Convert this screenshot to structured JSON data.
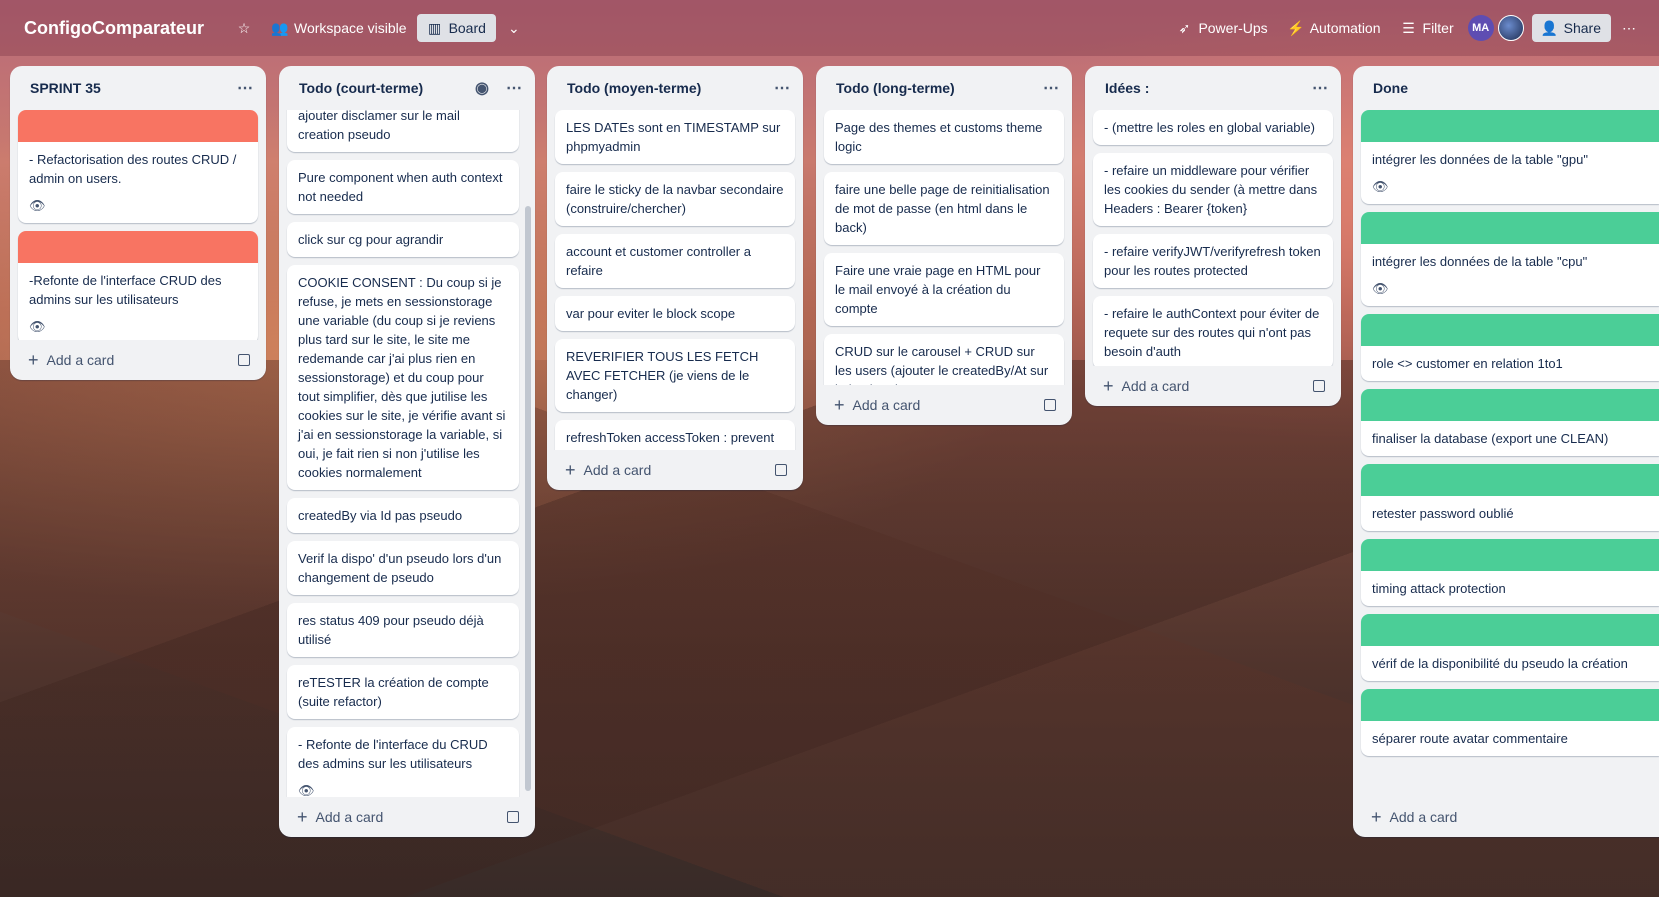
{
  "header": {
    "board_title": "ConfigoComparateur",
    "visibility_label": "Workspace visible",
    "view_label": "Board",
    "powerups_label": "Power-Ups",
    "automation_label": "Automation",
    "filter_label": "Filter",
    "avatar_initials": "MA",
    "share_label": "Share"
  },
  "colors": {
    "red_cover": "#f87462",
    "green_cover": "#4bce97"
  },
  "add_card_label": "Add a card",
  "lists": [
    {
      "title": "SPRINT 35",
      "cards": [
        {
          "text": "- Refactorisation des routes CRUD / admin on users."
        },
        {
          "text": "-Refonte de l'interface CRUD des admins sur les utilisateurs"
        }
      ]
    },
    {
      "title": "Todo (court-terme)",
      "cards": [
        {
          "text": "ajouter disclamer sur le mail creation pseudo"
        },
        {
          "text": "Pure component when auth context not needed"
        },
        {
          "text": "click sur cg pour agrandir"
        },
        {
          "text": "COOKIE CONSENT : Du coup si je refuse, je mets en sessionstorage une variable (du coup si je reviens plus tard sur le site, le site me redemande car j'ai plus rien en sessionstorage) et du coup pour tout simplifier, dès que jutilise les cookies sur le site, je vérifie avant si j'ai en sessionstorage la variable, si oui, je fait rien si non j'utilise les cookies normalement"
        },
        {
          "text": "createdBy via Id pas pseudo"
        },
        {
          "text": "Verif la dispo' d'un pseudo lors d'un changement de pseudo"
        },
        {
          "text": "res status 409 pour pseudo déjà utilisé"
        },
        {
          "text": "reTESTER la création de compte (suite refactor)"
        },
        {
          "text": "- Refonte de l'interface du CRUD des admins sur les utilisateurs"
        }
      ]
    },
    {
      "title": "Todo (moyen-terme)",
      "cards": [
        {
          "text": "LES DATEs sont en TIMESTAMP sur phpmyadmin"
        },
        {
          "text": "faire le sticky de la navbar secondaire (construire/chercher)"
        },
        {
          "text": "account et customer controller a refaire"
        },
        {
          "text": "var pour eviter le block scope"
        },
        {
          "text": "REVERIFIER TOUS LES FETCH AVEC FETCHER (je viens de le changer)"
        },
        {
          "text": "refreshToken accessToken : prevent cross-site scripting (XSS)"
        }
      ]
    },
    {
      "title": "Todo (long-terme)",
      "cards": [
        {
          "text": "Page des themes et customs theme logic"
        },
        {
          "text": "faire une belle page de reinitialisation de mot de passe (en html dans le back)"
        },
        {
          "text": "Faire une vraie page en HTML pour le mail envoyé à la création du compte"
        },
        {
          "text": "CRUD sur le carousel + CRUD sur les users (ajouter le createdBy/At sur le backend"
        }
      ]
    },
    {
      "title": "Idées :",
      "cards": [
        {
          "text": "- (mettre les roles en global variable)"
        },
        {
          "text": "- refaire un middleware pour vérifier les cookies du sender (à mettre dans Headers : Bearer {token}"
        },
        {
          "text": "- refaire verifyJWT/verifyrefresh token pour les routes protected"
        },
        {
          "text": "- refaire le authContext pour éviter de requete sur des routes qui n'ont pas besoin d'auth"
        }
      ]
    },
    {
      "title": "Done",
      "cards": [
        {
          "text": "intégrer les données de la table \"gpu\""
        },
        {
          "text": "intégrer les données de la table \"cpu\""
        },
        {
          "text": "role <> customer en relation 1to1"
        },
        {
          "text": "finaliser la database (export une CLEAN)"
        },
        {
          "text": "retester password oublié"
        },
        {
          "text": "timing attack protection"
        },
        {
          "text": "vérif de la disponibilité du pseudo la création"
        },
        {
          "text": "séparer route avatar commentaire"
        }
      ]
    }
  ]
}
